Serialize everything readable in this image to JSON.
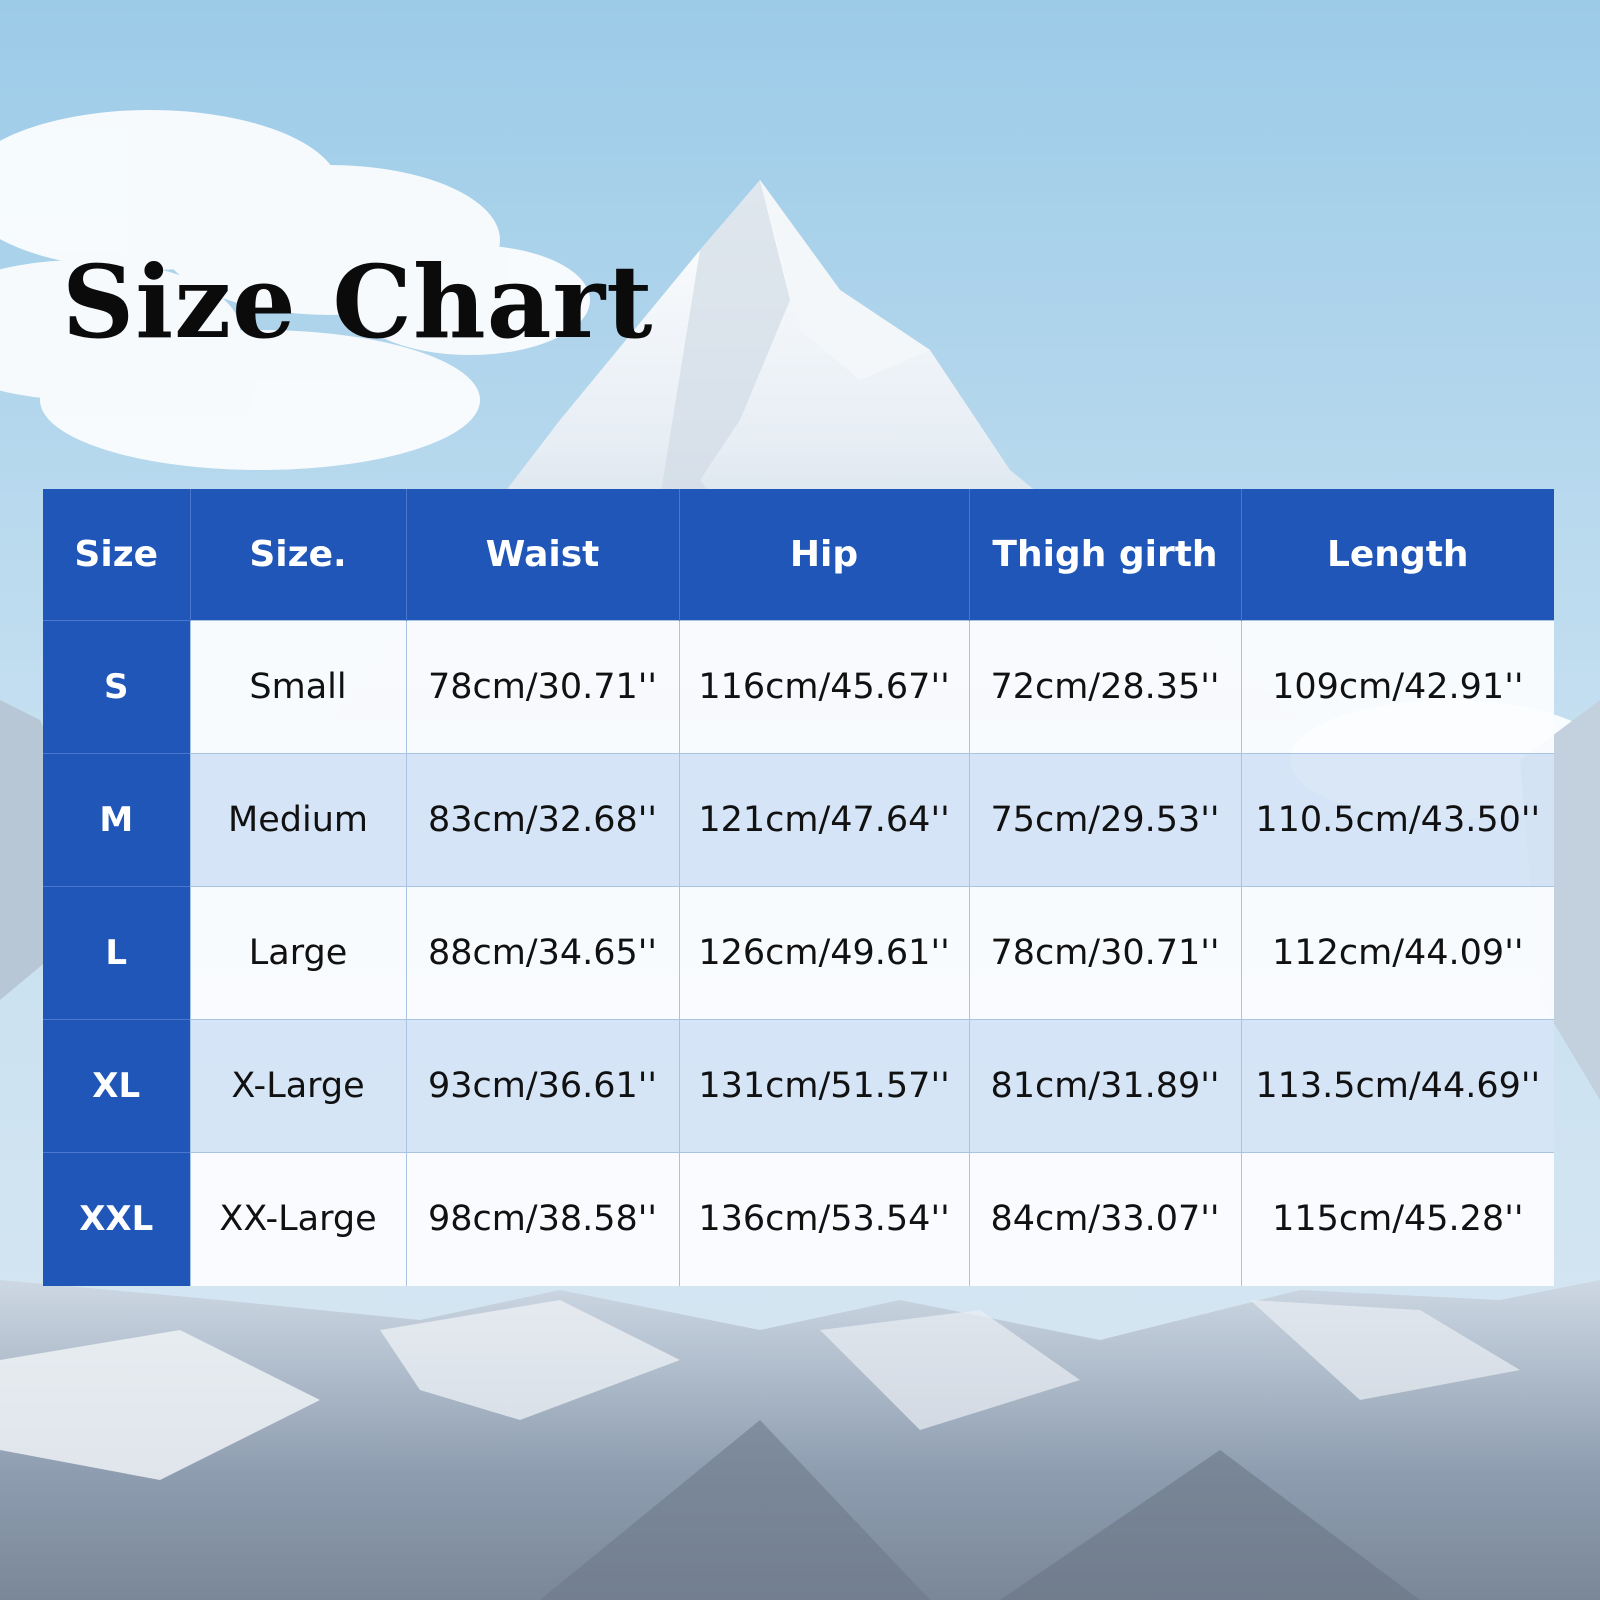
{
  "title": "Size Chart",
  "colors": {
    "header_blue": "#1f56b8",
    "sky_top": "#9ccbe8",
    "row_light": "#fcfdff",
    "row_tint": "#d6e4f6"
  },
  "background": {
    "icon": "mountain-landscape",
    "description": "snowy mountain peaks under blue sky"
  },
  "chart_data": {
    "type": "table",
    "columns": [
      "Size",
      "Size.",
      "Waist",
      "Hip",
      "Thigh girth",
      "Length"
    ],
    "rows": [
      [
        "S",
        "Small",
        "78cm/30.71''",
        "116cm/45.67''",
        "72cm/28.35''",
        "109cm/42.91''"
      ],
      [
        "M",
        "Medium",
        "83cm/32.68''",
        "121cm/47.64''",
        "75cm/29.53''",
        "110.5cm/43.50''"
      ],
      [
        "L",
        "Large",
        "88cm/34.65''",
        "126cm/49.61''",
        "78cm/30.71''",
        "112cm/44.09''"
      ],
      [
        "XL",
        "X-Large",
        "93cm/36.61''",
        "131cm/51.57''",
        "81cm/31.89''",
        "113.5cm/44.69''"
      ],
      [
        "XXL",
        "XX-Large",
        "98cm/38.58''",
        "136cm/53.54''",
        "84cm/33.07''",
        "115cm/45.28''"
      ]
    ]
  }
}
